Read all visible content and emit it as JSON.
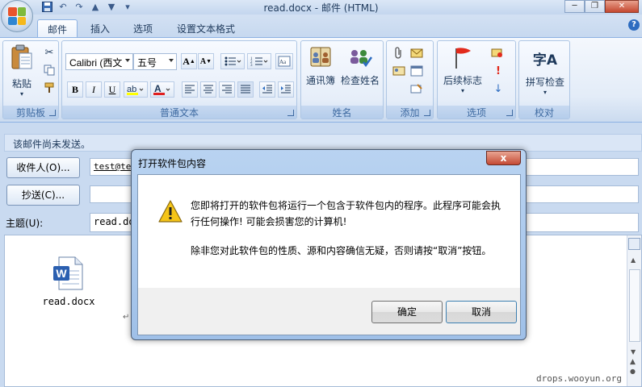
{
  "window": {
    "title": "read.docx - 邮件 (HTML)",
    "controls": [
      "minimize",
      "restore",
      "close"
    ]
  },
  "tabs": [
    {
      "label": "邮件",
      "active": true
    },
    {
      "label": "插入",
      "active": false
    },
    {
      "label": "选项",
      "active": false
    },
    {
      "label": "设置文本格式",
      "active": false
    }
  ],
  "ribbon": {
    "clipboard": {
      "label": "剪贴板",
      "paste": "粘贴"
    },
    "basic_text": {
      "label": "普通文本",
      "font": "Calibri (西文",
      "size": "五号"
    },
    "names": {
      "label": "姓名",
      "address_book": "通讯簿",
      "check_names": "检查姓名"
    },
    "include": {
      "label": "添加"
    },
    "options": {
      "label": "选项",
      "follow_up": "后续标志"
    },
    "proofing": {
      "label": "校对",
      "spelling": "拼写检查",
      "spelling_icon_text": "字A"
    }
  },
  "compose": {
    "notice": "该邮件尚未发送。",
    "to_button": "收件人(O)...",
    "to_value": "test@tes",
    "cc_button": "抄送(C)...",
    "cc_value": "",
    "subject_label": "主题(U):",
    "subject_value": "read.doc",
    "attachment_name": "read.docx"
  },
  "dialog": {
    "title": "打开软件包内容",
    "message_1": "您即将打开的软件包将运行一个包含于软件包内的程序。此程序可能会执行任何操作! 可能会损害您的计算机!",
    "message_2": "除非您对此软件包的性质、源和内容确信无疑，否则请按“取消”按钮。",
    "ok": "确定",
    "cancel": "取消",
    "close_glyph": "x"
  },
  "watermark": "drops.wooyun.org",
  "colors": {
    "ribbon_bg": "#e3ecf8",
    "accent": "#1e395b",
    "dialog_frame": "#a9c7ec"
  }
}
